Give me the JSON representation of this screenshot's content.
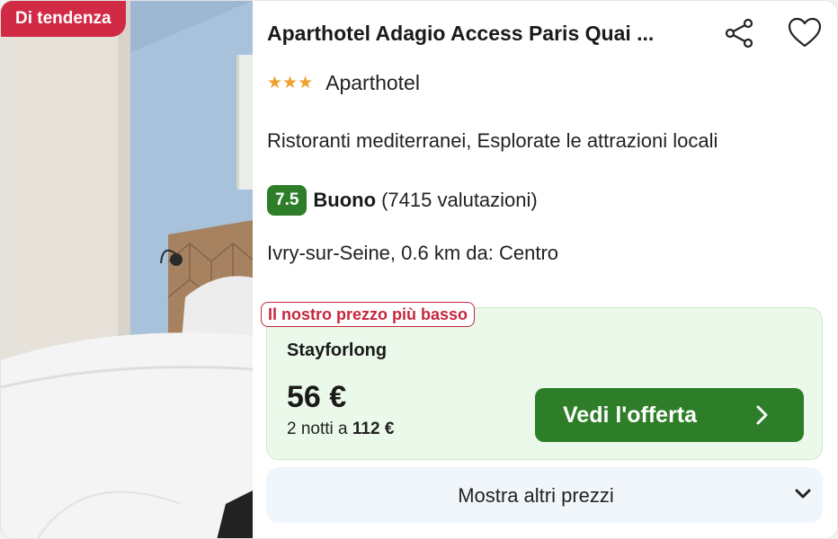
{
  "badge": "Di tendenza",
  "hotel": {
    "name": "Aparthotel Adagio Access Paris Quai ...",
    "stars": 3,
    "stars_text": "★★★",
    "type": "Aparthotel",
    "features": "Ristoranti mediterranei, Esplorate le attrazioni locali",
    "rating_score": "7.5",
    "rating_word": "Buono",
    "rating_count": "(7415 valutazioni)",
    "location": "Ivry-sur-Seine, 0.6 km da: Centro"
  },
  "offer": {
    "lowest_label": "Il nostro prezzo più basso",
    "provider": "Stayforlong",
    "price": "56 €",
    "nights_prefix": "2 notti a ",
    "nights_total": "112 €",
    "cta_label": "Vedi l'offerta"
  },
  "more_prices_label": "Mostra altri prezzi",
  "icons": {
    "share": "share-icon",
    "favorite": "heart-icon",
    "cta": "chevron-right-icon",
    "more": "chevron-down-icon"
  },
  "colors": {
    "badge": "#d12a44",
    "score": "#2e7d28",
    "cta": "#2e7d28",
    "offer_bg": "#ebf9ea",
    "lowest_border": "#c7273e",
    "stars": "#f0a030"
  }
}
